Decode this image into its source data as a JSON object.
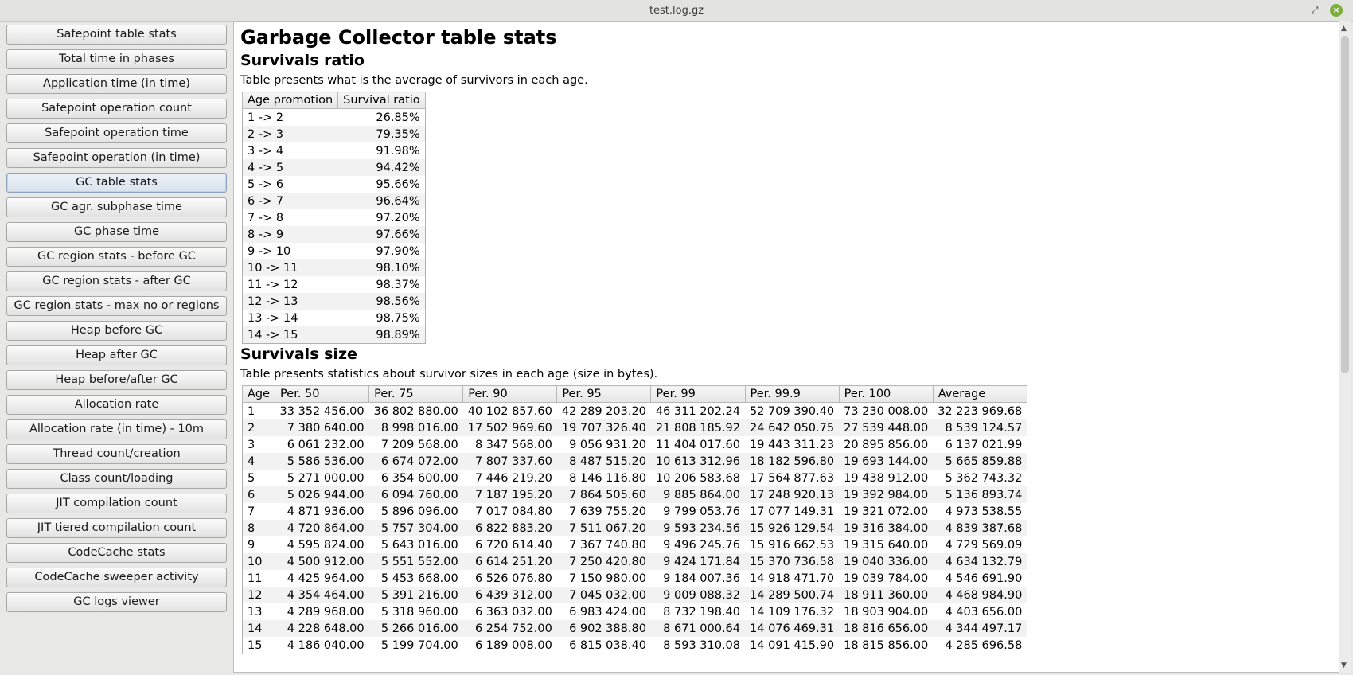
{
  "window": {
    "title": "test.log.gz"
  },
  "sidebar": {
    "items": [
      {
        "label": "Safepoint table stats",
        "active": false
      },
      {
        "label": "Total time in phases",
        "active": false
      },
      {
        "label": "Application time (in time)",
        "active": false
      },
      {
        "label": "Safepoint operation count",
        "active": false
      },
      {
        "label": "Safepoint operation time",
        "active": false
      },
      {
        "label": "Safepoint operation (in time)",
        "active": false
      },
      {
        "label": "GC table stats",
        "active": true
      },
      {
        "label": "GC agr. subphase time",
        "active": false
      },
      {
        "label": "GC phase time",
        "active": false
      },
      {
        "label": "GC region stats - before GC",
        "active": false
      },
      {
        "label": "GC region stats - after GC",
        "active": false
      },
      {
        "label": "GC region stats - max no or regions",
        "active": false
      },
      {
        "label": "Heap before GC",
        "active": false
      },
      {
        "label": "Heap after GC",
        "active": false
      },
      {
        "label": "Heap before/after GC",
        "active": false
      },
      {
        "label": "Allocation rate",
        "active": false
      },
      {
        "label": "Allocation rate (in time) - 10m",
        "active": false
      },
      {
        "label": "Thread count/creation",
        "active": false
      },
      {
        "label": "Class count/loading",
        "active": false
      },
      {
        "label": "JIT compilation count",
        "active": false
      },
      {
        "label": "JIT tiered compilation count",
        "active": false
      },
      {
        "label": "CodeCache stats",
        "active": false
      },
      {
        "label": "CodeCache sweeper activity",
        "active": false
      },
      {
        "label": "GC logs viewer",
        "active": false
      }
    ]
  },
  "content": {
    "title": "Garbage Collector table stats",
    "ratio_section": {
      "heading": "Survivals ratio",
      "description": "Table presents what is the average of survivors in each age.",
      "headers": [
        "Age promotion",
        "Survival ratio"
      ],
      "rows": [
        [
          "1 -> 2",
          "26.85%"
        ],
        [
          "2 -> 3",
          "79.35%"
        ],
        [
          "3 -> 4",
          "91.98%"
        ],
        [
          "4 -> 5",
          "94.42%"
        ],
        [
          "5 -> 6",
          "95.66%"
        ],
        [
          "6 -> 7",
          "96.64%"
        ],
        [
          "7 -> 8",
          "97.20%"
        ],
        [
          "8 -> 9",
          "97.66%"
        ],
        [
          "9 -> 10",
          "97.90%"
        ],
        [
          "10 -> 11",
          "98.10%"
        ],
        [
          "11 -> 12",
          "98.37%"
        ],
        [
          "12 -> 13",
          "98.56%"
        ],
        [
          "13 -> 14",
          "98.75%"
        ],
        [
          "14 -> 15",
          "98.89%"
        ]
      ]
    },
    "size_section": {
      "heading": "Survivals size",
      "description": "Table presents statistics about survivor sizes in each age (size in bytes).",
      "headers": [
        "Age",
        "Per. 50",
        "Per. 75",
        "Per. 90",
        "Per. 95",
        "Per. 99",
        "Per. 99.9",
        "Per. 100",
        "Average"
      ],
      "rows": [
        [
          "1",
          "33 352 456.00",
          "36 802 880.00",
          "40 102 857.60",
          "42 289 203.20",
          "46 311 202.24",
          "52 709 390.40",
          "73 230 008.00",
          "32 223 969.68"
        ],
        [
          "2",
          "7 380 640.00",
          "8 998 016.00",
          "17 502 969.60",
          "19 707 326.40",
          "21 808 185.92",
          "24 642 050.75",
          "27 539 448.00",
          "8 539 124.57"
        ],
        [
          "3",
          "6 061 232.00",
          "7 209 568.00",
          "8 347 568.00",
          "9 056 931.20",
          "11 404 017.60",
          "19 443 311.23",
          "20 895 856.00",
          "6 137 021.99"
        ],
        [
          "4",
          "5 586 536.00",
          "6 674 072.00",
          "7 807 337.60",
          "8 487 515.20",
          "10 613 312.96",
          "18 182 596.80",
          "19 693 144.00",
          "5 665 859.88"
        ],
        [
          "5",
          "5 271 000.00",
          "6 354 600.00",
          "7 446 219.20",
          "8 146 116.80",
          "10 206 583.68",
          "17 564 877.63",
          "19 438 912.00",
          "5 362 743.32"
        ],
        [
          "6",
          "5 026 944.00",
          "6 094 760.00",
          "7 187 195.20",
          "7 864 505.60",
          "9 885 864.00",
          "17 248 920.13",
          "19 392 984.00",
          "5 136 893.74"
        ],
        [
          "7",
          "4 871 936.00",
          "5 896 096.00",
          "7 017 084.80",
          "7 639 755.20",
          "9 799 053.76",
          "17 077 149.31",
          "19 321 072.00",
          "4 973 538.55"
        ],
        [
          "8",
          "4 720 864.00",
          "5 757 304.00",
          "6 822 883.20",
          "7 511 067.20",
          "9 593 234.56",
          "15 926 129.54",
          "19 316 384.00",
          "4 839 387.68"
        ],
        [
          "9",
          "4 595 824.00",
          "5 643 016.00",
          "6 720 614.40",
          "7 367 740.80",
          "9 496 245.76",
          "15 916 662.53",
          "19 315 640.00",
          "4 729 569.09"
        ],
        [
          "10",
          "4 500 912.00",
          "5 551 552.00",
          "6 614 251.20",
          "7 250 420.80",
          "9 424 171.84",
          "15 370 736.58",
          "19 040 336.00",
          "4 634 132.79"
        ],
        [
          "11",
          "4 425 964.00",
          "5 453 668.00",
          "6 526 076.80",
          "7 150 980.00",
          "9 184 007.36",
          "14 918 471.70",
          "19 039 784.00",
          "4 546 691.90"
        ],
        [
          "12",
          "4 354 464.00",
          "5 391 216.00",
          "6 439 312.00",
          "7 045 032.00",
          "9 009 088.32",
          "14 289 500.74",
          "18 911 360.00",
          "4 468 984.90"
        ],
        [
          "13",
          "4 289 968.00",
          "5 318 960.00",
          "6 363 032.00",
          "6 983 424.00",
          "8 732 198.40",
          "14 109 176.32",
          "18 903 904.00",
          "4 403 656.00"
        ],
        [
          "14",
          "4 228 648.00",
          "5 266 016.00",
          "6 254 752.00",
          "6 902 388.80",
          "8 671 000.64",
          "14 076 469.31",
          "18 816 656.00",
          "4 344 497.17"
        ],
        [
          "15",
          "4 186 040.00",
          "5 199 704.00",
          "6 189 008.00",
          "6 815 038.40",
          "8 593 310.08",
          "14 091 415.90",
          "18 815 856.00",
          "4 285 696.58"
        ]
      ]
    }
  }
}
